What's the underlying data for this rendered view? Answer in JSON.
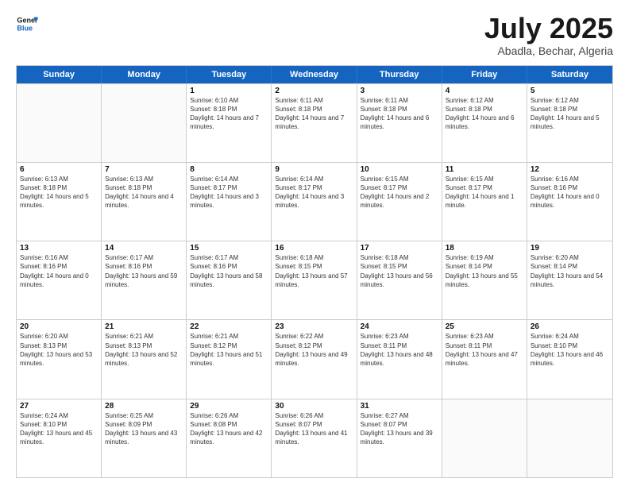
{
  "header": {
    "logo_line1": "General",
    "logo_line2": "Blue",
    "title": "July 2025",
    "subtitle": "Abadla, Bechar, Algeria"
  },
  "weekdays": [
    "Sunday",
    "Monday",
    "Tuesday",
    "Wednesday",
    "Thursday",
    "Friday",
    "Saturday"
  ],
  "weeks": [
    [
      {
        "day": "",
        "info": ""
      },
      {
        "day": "",
        "info": ""
      },
      {
        "day": "1",
        "info": "Sunrise: 6:10 AM\nSunset: 8:18 PM\nDaylight: 14 hours and 7 minutes."
      },
      {
        "day": "2",
        "info": "Sunrise: 6:11 AM\nSunset: 8:18 PM\nDaylight: 14 hours and 7 minutes."
      },
      {
        "day": "3",
        "info": "Sunrise: 6:11 AM\nSunset: 8:18 PM\nDaylight: 14 hours and 6 minutes."
      },
      {
        "day": "4",
        "info": "Sunrise: 6:12 AM\nSunset: 8:18 PM\nDaylight: 14 hours and 6 minutes."
      },
      {
        "day": "5",
        "info": "Sunrise: 6:12 AM\nSunset: 8:18 PM\nDaylight: 14 hours and 5 minutes."
      }
    ],
    [
      {
        "day": "6",
        "info": "Sunrise: 6:13 AM\nSunset: 8:18 PM\nDaylight: 14 hours and 5 minutes."
      },
      {
        "day": "7",
        "info": "Sunrise: 6:13 AM\nSunset: 8:18 PM\nDaylight: 14 hours and 4 minutes."
      },
      {
        "day": "8",
        "info": "Sunrise: 6:14 AM\nSunset: 8:17 PM\nDaylight: 14 hours and 3 minutes."
      },
      {
        "day": "9",
        "info": "Sunrise: 6:14 AM\nSunset: 8:17 PM\nDaylight: 14 hours and 3 minutes."
      },
      {
        "day": "10",
        "info": "Sunrise: 6:15 AM\nSunset: 8:17 PM\nDaylight: 14 hours and 2 minutes."
      },
      {
        "day": "11",
        "info": "Sunrise: 6:15 AM\nSunset: 8:17 PM\nDaylight: 14 hours and 1 minute."
      },
      {
        "day": "12",
        "info": "Sunrise: 6:16 AM\nSunset: 8:16 PM\nDaylight: 14 hours and 0 minutes."
      }
    ],
    [
      {
        "day": "13",
        "info": "Sunrise: 6:16 AM\nSunset: 8:16 PM\nDaylight: 14 hours and 0 minutes."
      },
      {
        "day": "14",
        "info": "Sunrise: 6:17 AM\nSunset: 8:16 PM\nDaylight: 13 hours and 59 minutes."
      },
      {
        "day": "15",
        "info": "Sunrise: 6:17 AM\nSunset: 8:16 PM\nDaylight: 13 hours and 58 minutes."
      },
      {
        "day": "16",
        "info": "Sunrise: 6:18 AM\nSunset: 8:15 PM\nDaylight: 13 hours and 57 minutes."
      },
      {
        "day": "17",
        "info": "Sunrise: 6:18 AM\nSunset: 8:15 PM\nDaylight: 13 hours and 56 minutes."
      },
      {
        "day": "18",
        "info": "Sunrise: 6:19 AM\nSunset: 8:14 PM\nDaylight: 13 hours and 55 minutes."
      },
      {
        "day": "19",
        "info": "Sunrise: 6:20 AM\nSunset: 8:14 PM\nDaylight: 13 hours and 54 minutes."
      }
    ],
    [
      {
        "day": "20",
        "info": "Sunrise: 6:20 AM\nSunset: 8:13 PM\nDaylight: 13 hours and 53 minutes."
      },
      {
        "day": "21",
        "info": "Sunrise: 6:21 AM\nSunset: 8:13 PM\nDaylight: 13 hours and 52 minutes."
      },
      {
        "day": "22",
        "info": "Sunrise: 6:21 AM\nSunset: 8:12 PM\nDaylight: 13 hours and 51 minutes."
      },
      {
        "day": "23",
        "info": "Sunrise: 6:22 AM\nSunset: 8:12 PM\nDaylight: 13 hours and 49 minutes."
      },
      {
        "day": "24",
        "info": "Sunrise: 6:23 AM\nSunset: 8:11 PM\nDaylight: 13 hours and 48 minutes."
      },
      {
        "day": "25",
        "info": "Sunrise: 6:23 AM\nSunset: 8:11 PM\nDaylight: 13 hours and 47 minutes."
      },
      {
        "day": "26",
        "info": "Sunrise: 6:24 AM\nSunset: 8:10 PM\nDaylight: 13 hours and 46 minutes."
      }
    ],
    [
      {
        "day": "27",
        "info": "Sunrise: 6:24 AM\nSunset: 8:10 PM\nDaylight: 13 hours and 45 minutes."
      },
      {
        "day": "28",
        "info": "Sunrise: 6:25 AM\nSunset: 8:09 PM\nDaylight: 13 hours and 43 minutes."
      },
      {
        "day": "29",
        "info": "Sunrise: 6:26 AM\nSunset: 8:08 PM\nDaylight: 13 hours and 42 minutes."
      },
      {
        "day": "30",
        "info": "Sunrise: 6:26 AM\nSunset: 8:07 PM\nDaylight: 13 hours and 41 minutes."
      },
      {
        "day": "31",
        "info": "Sunrise: 6:27 AM\nSunset: 8:07 PM\nDaylight: 13 hours and 39 minutes."
      },
      {
        "day": "",
        "info": ""
      },
      {
        "day": "",
        "info": ""
      }
    ]
  ]
}
